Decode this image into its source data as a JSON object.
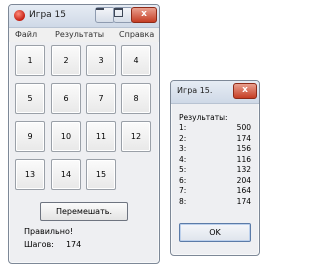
{
  "main_window": {
    "title": "Игра 15",
    "minimize_glyph": "",
    "maximize_glyph": "",
    "close_glyph": "x",
    "menu": [
      "Файл",
      "Результаты",
      "Справка"
    ],
    "tiles": [
      "1",
      "2",
      "3",
      "4",
      "5",
      "6",
      "7",
      "8",
      "9",
      "10",
      "11",
      "12",
      "13",
      "14",
      "15"
    ],
    "shuffle_label": "Перемешать.",
    "status_text": "Правильно!",
    "moves_label": "Шагов:",
    "moves_value": "174"
  },
  "results_window": {
    "title": "Игра 15.",
    "close_glyph": "x",
    "label": "Результаты:",
    "rows": [
      {
        "k": "1:",
        "v": "500"
      },
      {
        "k": "2:",
        "v": "174"
      },
      {
        "k": "3:",
        "v": "156"
      },
      {
        "k": "4:",
        "v": "116"
      },
      {
        "k": "5:",
        "v": "132"
      },
      {
        "k": "6:",
        "v": "204"
      },
      {
        "k": "7:",
        "v": "164"
      },
      {
        "k": "8:",
        "v": "174"
      }
    ],
    "ok_label": "OK"
  }
}
